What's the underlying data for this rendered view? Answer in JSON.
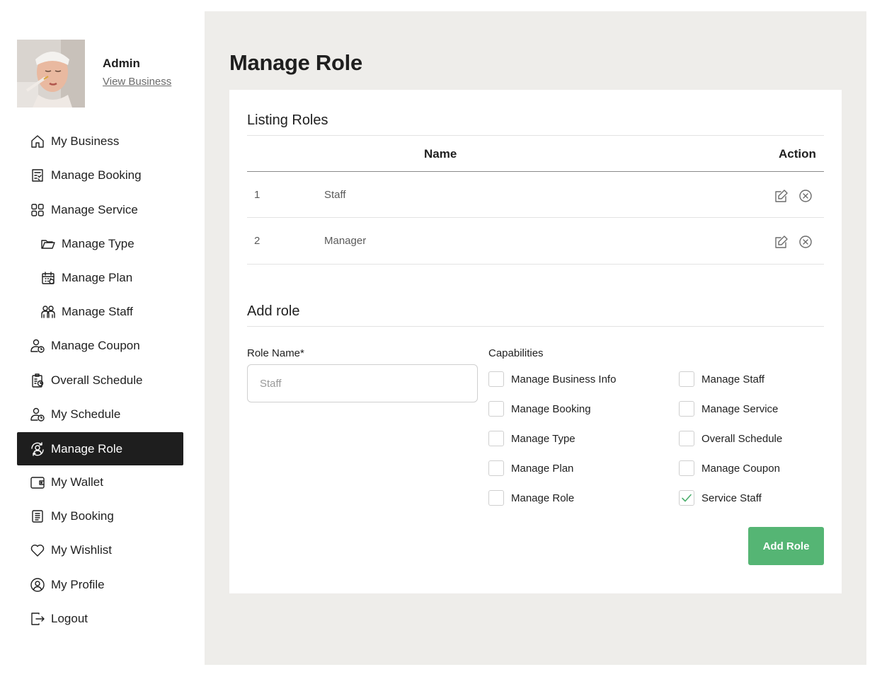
{
  "profile": {
    "name": "Admin",
    "link": "View Business"
  },
  "sidebar": {
    "items": [
      {
        "label": "My Business",
        "icon": "home-icon"
      },
      {
        "label": "Manage Booking",
        "icon": "booking-list-icon"
      },
      {
        "label": "Manage Service",
        "icon": "grid-icon"
      },
      {
        "label": "Manage Type",
        "icon": "folder-icon"
      },
      {
        "label": "Manage Plan",
        "icon": "calendar-icon"
      },
      {
        "label": "Manage Staff",
        "icon": "staff-group-icon"
      },
      {
        "label": "Manage Coupon",
        "icon": "user-clock-icon"
      },
      {
        "label": "Overall Schedule",
        "icon": "clipboard-schedule-icon"
      },
      {
        "label": "My Schedule",
        "icon": "user-clock-icon"
      },
      {
        "label": "Manage Role",
        "icon": "role-cycle-icon",
        "active": true
      },
      {
        "label": "My Wallet",
        "icon": "wallet-icon"
      },
      {
        "label": "My Booking",
        "icon": "document-icon"
      },
      {
        "label": "My Wishlist",
        "icon": "heart-icon"
      },
      {
        "label": "My Profile",
        "icon": "user-circle-icon"
      },
      {
        "label": "Logout",
        "icon": "logout-icon"
      }
    ]
  },
  "page": {
    "title": "Manage Role"
  },
  "listing": {
    "title": "Listing Roles",
    "columns": {
      "name": "Name",
      "action": "Action"
    },
    "rows": [
      {
        "index": "1",
        "name": "Staff"
      },
      {
        "index": "2",
        "name": "Manager"
      }
    ]
  },
  "add_role": {
    "title": "Add role",
    "role_name_label": "Role Name*",
    "role_name_placeholder": "Staff",
    "capabilities_label": "Capabilities",
    "capabilities": [
      {
        "label": "Manage Business Info",
        "checked": false
      },
      {
        "label": "Manage Staff",
        "checked": false
      },
      {
        "label": "Manage Booking",
        "checked": false
      },
      {
        "label": "Manage Service",
        "checked": false
      },
      {
        "label": "Manage Type",
        "checked": false
      },
      {
        "label": "Overall Schedule",
        "checked": false
      },
      {
        "label": "Manage Plan",
        "checked": false
      },
      {
        "label": "Manage Coupon",
        "checked": false
      },
      {
        "label": "Manage Role",
        "checked": false
      },
      {
        "label": "Service Staff",
        "checked": true
      }
    ],
    "submit_label": "Add Role"
  },
  "colors": {
    "active_nav_bg": "#1e1e1e",
    "main_bg": "#eeedea",
    "submit_bg": "#55b574",
    "check_color": "#4caf6d"
  }
}
